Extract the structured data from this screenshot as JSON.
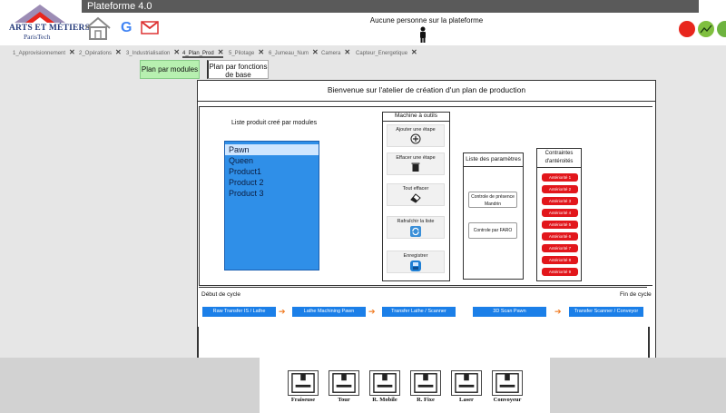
{
  "app": {
    "title": "Plateforme 4.0",
    "logo_line1": "ARTS ET MÉTIERS",
    "logo_line2": "ParisTech"
  },
  "header": {
    "status": "Aucune personne sur la plateforme",
    "google_label": "G",
    "colors": {
      "red": "#e8261d",
      "green": "#7fbf3f",
      "green2": "#6db33f"
    }
  },
  "tabs": [
    {
      "label": "1_Approvisionnement"
    },
    {
      "label": "2_Opérations"
    },
    {
      "label": "3_Industrialisation"
    },
    {
      "label": "4_Plan_Prod"
    },
    {
      "label": "5_Pilotage"
    },
    {
      "label": "6_Jumeau_Num"
    },
    {
      "label": "Camera"
    },
    {
      "label": "Capteur_Energetique"
    }
  ],
  "subtabs": {
    "modules": "Plan par modules",
    "functions": "Plan par fonctions de base"
  },
  "main": {
    "welcome": "Bienvenue sur l'atelier de création d'un plan de production",
    "list_title": "Liste produit creé par modules",
    "products": [
      "Pawn",
      "Queen",
      "Product1",
      "Product 2",
      "Product 3"
    ],
    "machine_title": "Machine à outils",
    "tools": [
      {
        "label": "Ajouter une étape",
        "icon": "plus-circle-icon"
      },
      {
        "label": "Effacer une étape",
        "icon": "trash-icon"
      },
      {
        "label": "Tout effacer",
        "icon": "eraser-icon"
      },
      {
        "label": "Rafraîchir la liste",
        "icon": "refresh-icon"
      },
      {
        "label": "Enregistrer",
        "icon": "save-icon"
      }
    ],
    "params_title": "Liste des paramètres",
    "params": [
      "Controle de présence Mandrin",
      "Controle par FARO"
    ],
    "constraints_title": "Contraintes d'antéroités",
    "constraints": [
      "Antériorité 1",
      "Antériorité 2",
      "Antériorité 3",
      "Antériorité 4",
      "Antériorité 5",
      "Antériorité 6",
      "Antériorité 7",
      "Antériorité 8",
      "Antériorité 9"
    ],
    "cycle_start": "Début de cycle",
    "cycle_end": "Fin de cycle",
    "steps": [
      "Raw Transfer IS / Lathe",
      "Lathe Machining Pawn",
      "Transfer Lathe / Scanner",
      "3D Scan Pawn",
      "Transfer Scanner / Conveyor"
    ]
  },
  "footer": {
    "machines": [
      "Fraiseuse",
      "Tour",
      "R. Mobile",
      "R. Fixe",
      "Laser",
      "Convoyeur"
    ]
  }
}
